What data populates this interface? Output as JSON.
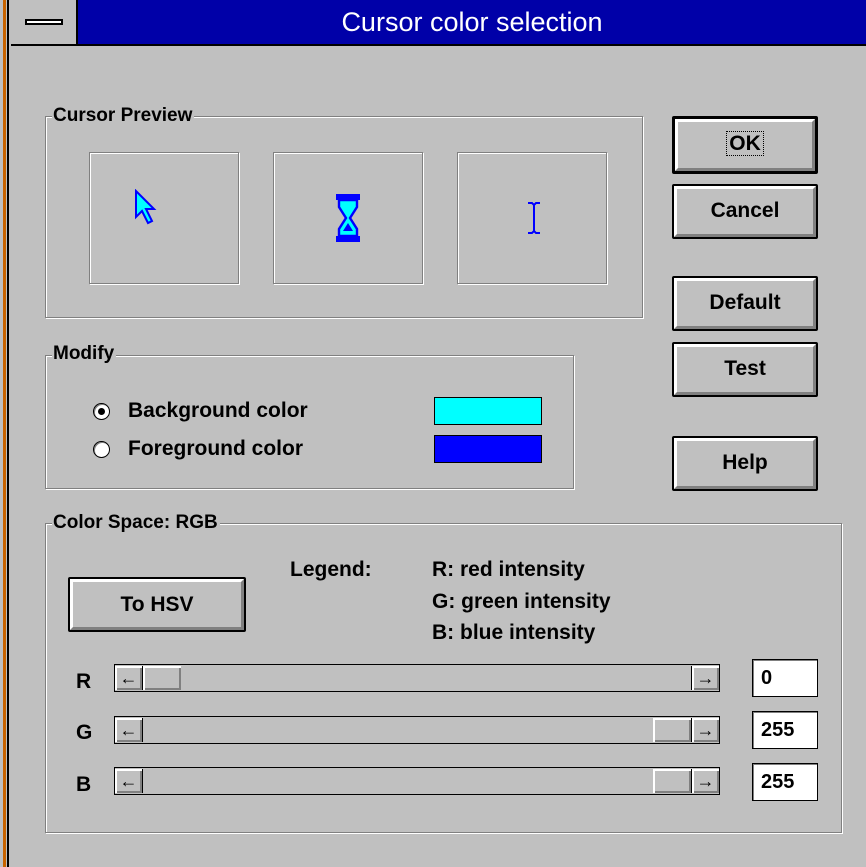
{
  "window": {
    "title": "Cursor color selection"
  },
  "preview": {
    "label": "Cursor Preview",
    "cursors": [
      "arrow-cursor-icon",
      "hourglass-cursor-icon",
      "ibeam-cursor-icon"
    ]
  },
  "buttons": {
    "ok": "OK",
    "cancel": "Cancel",
    "default": "Default",
    "test": "Test",
    "help": "Help",
    "to_hsv": "To HSV"
  },
  "modify": {
    "label": "Modify",
    "options": [
      {
        "label": "Background color",
        "selected": true,
        "color": "#00ffff"
      },
      {
        "label": "Foreground color",
        "selected": false,
        "color": "#0000ff"
      }
    ]
  },
  "colorspace": {
    "label": "Color Space: RGB",
    "legend_label": "Legend:",
    "legend": [
      "R: red intensity",
      "G: green intensity",
      "B: blue intensity"
    ],
    "channels": [
      {
        "name": "R",
        "value": "0",
        "level": 0
      },
      {
        "name": "G",
        "value": "255",
        "level": 255
      },
      {
        "name": "B",
        "value": "255",
        "level": 255
      }
    ]
  },
  "colors": {
    "titlebar": "#0000a8",
    "cursor_fill": "#00ffff",
    "cursor_outline": "#0000ff"
  }
}
